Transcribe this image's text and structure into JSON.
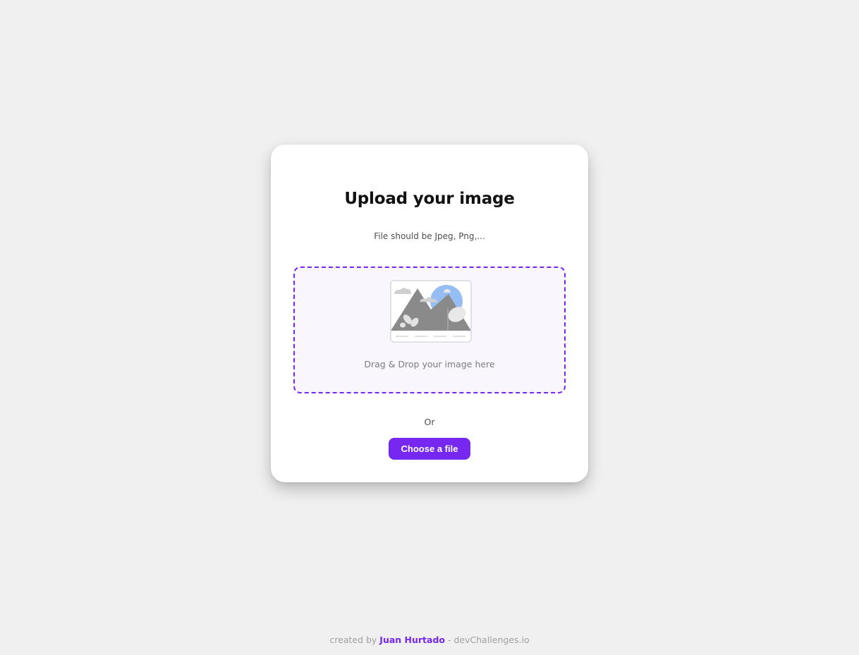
{
  "card": {
    "title": "Upload your image",
    "subtitle": "File should be Jpeg, Png,..."
  },
  "dropzone": {
    "illustration_icon": "image-placeholder-icon",
    "text": "Drag & Drop your image here"
  },
  "divider_text": "Or",
  "choose_button": {
    "label": "Choose a file"
  },
  "footer": {
    "prefix": "created by",
    "author": "Juan Hurtado",
    "suffix": "- devChallenges.io"
  },
  "colors": {
    "accent": "#7628f0",
    "background": "#f0f0f0",
    "card": "#ffffff",
    "dropzone_bg": "#f9f6fd"
  }
}
